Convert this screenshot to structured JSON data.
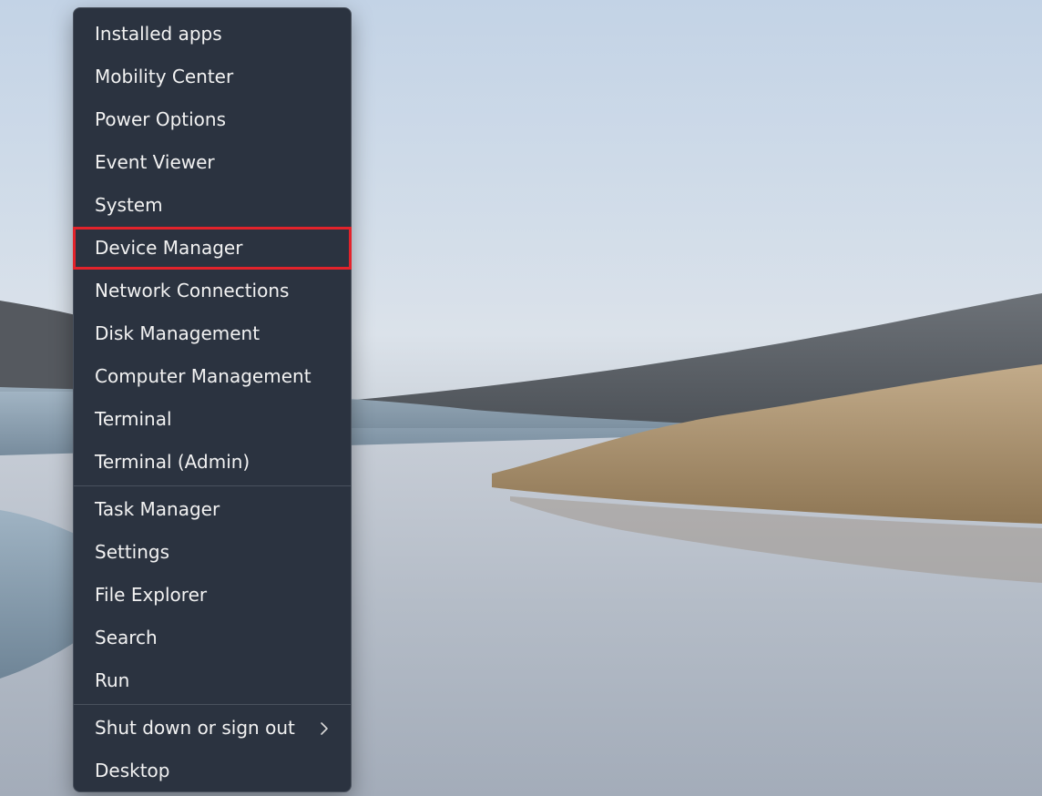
{
  "menu": {
    "group1": [
      {
        "label": "Installed apps"
      },
      {
        "label": "Mobility Center"
      },
      {
        "label": "Power Options"
      },
      {
        "label": "Event Viewer"
      },
      {
        "label": "System"
      },
      {
        "label": "Device Manager",
        "highlighted": true
      },
      {
        "label": "Network Connections"
      },
      {
        "label": "Disk Management"
      },
      {
        "label": "Computer Management"
      },
      {
        "label": "Terminal"
      },
      {
        "label": "Terminal (Admin)"
      }
    ],
    "group2": [
      {
        "label": "Task Manager"
      },
      {
        "label": "Settings"
      },
      {
        "label": "File Explorer"
      },
      {
        "label": "Search"
      },
      {
        "label": "Run"
      }
    ],
    "group3": [
      {
        "label": "Shut down or sign out",
        "submenu_icon": "chevron-right-icon"
      },
      {
        "label": "Desktop"
      }
    ]
  },
  "colors": {
    "menu_background": "#2b3340",
    "menu_text": "#f2f2f2",
    "highlight_outline": "#e3232b"
  }
}
